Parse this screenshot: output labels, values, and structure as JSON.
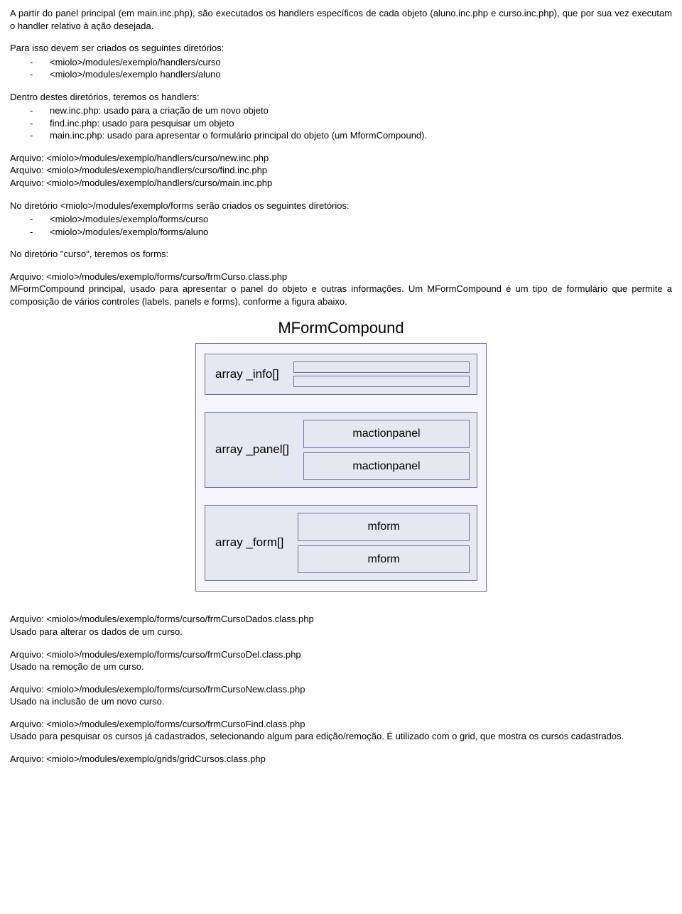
{
  "p1": "A partir do panel principal (em main.inc.php), são executados os handlers específicos de cada objeto (aluno.inc.php e curso.inc.php), que por sua vez executam o handler relativo à ação desejada.",
  "p2_intro": "Para isso devem ser criados os seguintes diretórios:",
  "p2_items": [
    "<miolo>/modules/exemplo/handlers/curso",
    "<miolo>/modules/exemplo handlers/aluno"
  ],
  "p3_intro": "Dentro destes diretórios, teremos os handlers:",
  "p3_items": [
    "new.inc.php: usado para a criação de um novo objeto",
    "find.inc.php: usado para pesquisar um objeto",
    "main.inc.php: usado para apresentar o formulário principal do objeto (um MformCompound)."
  ],
  "file_block1": [
    "Arquivo: <miolo>/modules/exemplo/handlers/curso/new.inc.php",
    "Arquivo: <miolo>/modules/exemplo/handlers/curso/find.inc.php",
    "Arquivo: <miolo>/modules/exemplo/handlers/curso/main.inc.php"
  ],
  "p4_intro": "No diretório <miolo>/modules/exemplo/forms serão criados os seguintes diretórios:",
  "p4_items": [
    "<miolo>/modules/exemplo/forms/curso",
    "<miolo>/modules/exemplo/forms/aluno"
  ],
  "p5": "No diretório \"curso\", teremos os forms:",
  "p6_line1": "Arquivo: <miolo>/modules/exemplo/forms/curso/frmCurso.class.php",
  "p6_line2": "MFormCompound principal, usado para apresentar o panel do objeto e outras informações. Um MFormCompound é um tipo de formulário que permite a composição de vários controles (labels, panels e forms), conforme a figura abaixo.",
  "diagram": {
    "title": "MFormCompound",
    "info_label": "array _info[]",
    "panel_label": "array _panel[]",
    "panel_items": [
      "mactionpanel",
      "mactionpanel"
    ],
    "form_label": "array _form[]",
    "form_items": [
      "mform",
      "mform"
    ]
  },
  "blocks": [
    {
      "title": "Arquivo: <miolo>/modules/exemplo/forms/curso/frmCursoDados.class.php",
      "desc": "Usado para alterar os dados de um curso."
    },
    {
      "title": "Arquivo: <miolo>/modules/exemplo/forms/curso/frmCursoDel.class.php",
      "desc": "Usado na remoção de um curso."
    },
    {
      "title": "Arquivo: <miolo>/modules/exemplo/forms/curso/frmCursoNew.class.php",
      "desc": "Usado na inclusão de um novo curso."
    },
    {
      "title": "Arquivo: <miolo>/modules/exemplo/forms/curso/frmCursoFind.class.php",
      "desc": "Usado para pesquisar os cursos já cadastrados, selecionando algum para edição/remoção. É utilizado com o grid, que mostra os cursos cadastrados."
    }
  ],
  "last_line": "Arquivo: <miolo>/modules/exemplo/grids/gridCursos.class.php"
}
